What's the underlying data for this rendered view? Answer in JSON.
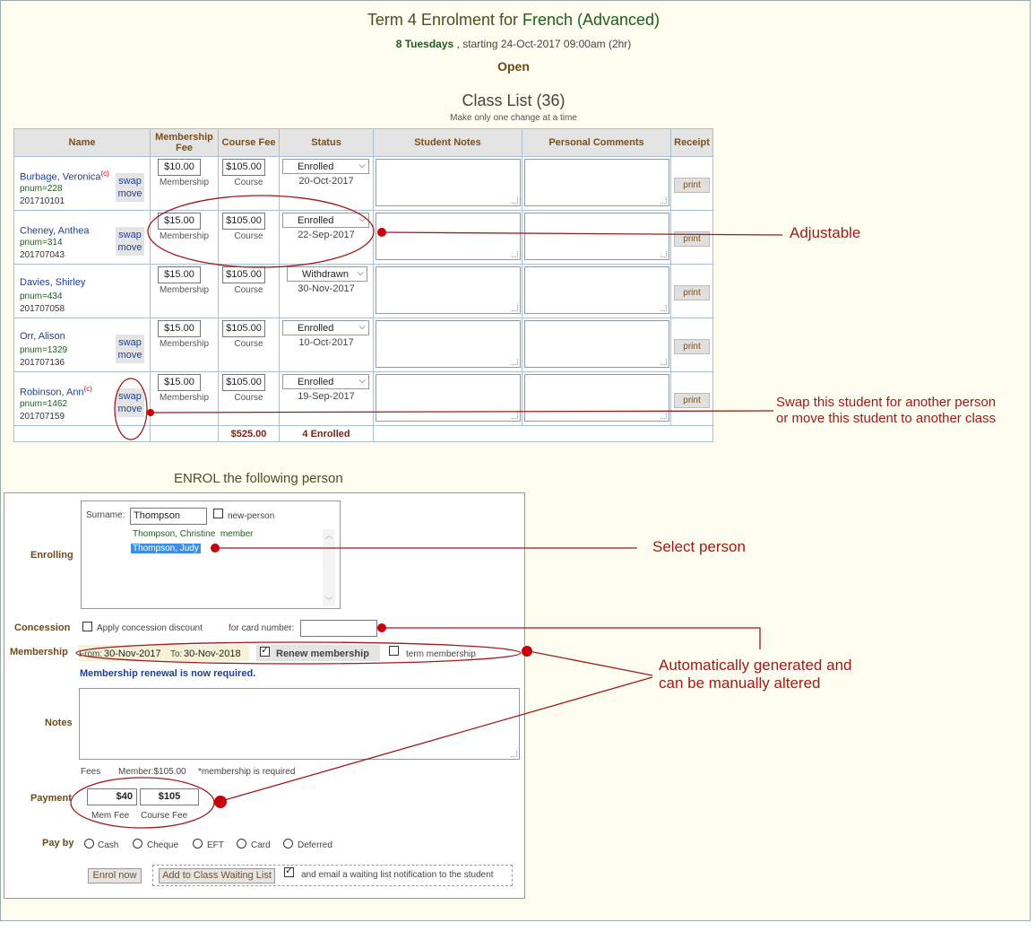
{
  "header": {
    "title_prefix": "Term 4 Enrolment for ",
    "course": "French (Advanced)",
    "sessions": "8 Tuesdays",
    "schedule": ", starting 24-Oct-2017 09:00am (2hr)",
    "status": "Open"
  },
  "class_list": {
    "title": "Class List (36)",
    "note": "Make only one change at a time",
    "columns": [
      "Name",
      "Membership Fee",
      "Course Fee",
      "Status",
      "Student Notes",
      "Personal Comments",
      "Receipt"
    ],
    "rows": [
      {
        "name": "Burbage, Veronica",
        "flag": "(c)",
        "pnum": "pnum=228",
        "mid": "201710101",
        "swap": "swap",
        "move": "move",
        "mem_fee": "$10.00",
        "mem_label": "Membership",
        "course_fee": "$105.00",
        "course_label": "Course",
        "status": "Enrolled",
        "date": "20-Oct-2017",
        "receipt": "print"
      },
      {
        "name": "Cheney, Anthea",
        "flag": "",
        "pnum": "pnum=314",
        "mid": "201707043",
        "swap": "swap",
        "move": "move",
        "mem_fee": "$15.00",
        "mem_label": "Membership",
        "course_fee": "$105.00",
        "course_label": "Course",
        "status": "Enrolled",
        "date": "22-Sep-2017",
        "receipt": "print"
      },
      {
        "name": "Davies, Shirley",
        "flag": "",
        "pnum": "pnum=434",
        "mid": "201707058",
        "swap": "",
        "move": "",
        "mem_fee": "$15.00",
        "mem_label": "Membership",
        "course_fee": "$105.00",
        "course_label": "Course",
        "status": "Withdrawn",
        "date": "30-Nov-2017",
        "receipt": "print"
      },
      {
        "name": "Orr, Alison",
        "flag": "",
        "pnum": "pnum=1329",
        "mid": "201707136",
        "swap": "swap",
        "move": "move",
        "mem_fee": "$15.00",
        "mem_label": "Membership",
        "course_fee": "$105.00",
        "course_label": "Course",
        "status": "Enrolled",
        "date": "10-Oct-2017",
        "receipt": "print"
      },
      {
        "name": "Robinson, Ann",
        "flag": "(c)",
        "pnum": "pnum=1462",
        "mid": "201707159",
        "swap": "swap",
        "move": "move",
        "mem_fee": "$15.00",
        "mem_label": "Membership",
        "course_fee": "$105.00",
        "course_label": "Course",
        "status": "Enrolled",
        "date": "19-Sep-2017",
        "receipt": "print"
      }
    ],
    "total_fee": "$525.00",
    "total_enrolled": "4 Enrolled"
  },
  "enrol": {
    "title": "ENROL the following person",
    "enrolling_label": "Enrolling",
    "surname_label": "Surname:",
    "surname_value": "Thompson",
    "new_person_label": "new-person",
    "results": [
      {
        "text": "Thompson, Christine  member"
      },
      {
        "text": "Thompson, Judy"
      }
    ],
    "concession_label": "Concession",
    "concession_text": "Apply concession discount",
    "card_label": "for card number:",
    "membership_label": "Membership",
    "from_label": "From:",
    "from_date": "30-Nov-2017",
    "to_label": "To:",
    "to_date": "30-Nov-2018",
    "renew_label": "Renew membership",
    "term_label": "term membership",
    "renewal_msg": "Membership renewal is now required.",
    "notes_label": "Notes",
    "fees_label": "Fees",
    "fees_member": "Member:$105.00",
    "fees_note": "*membership is required",
    "payment_label": "Payment",
    "mem_fee": "$40",
    "course_fee": "$105",
    "mem_fee_label": "Mem Fee",
    "course_fee_label": "Course Fee",
    "payby_label": "Pay by",
    "pay_options": [
      "Cash",
      "Cheque",
      "EFT",
      "Card",
      "Deferred"
    ],
    "enrol_button": "Enrol now",
    "waitlist_button": "Add to Class Waiting List",
    "waitlist_email": "and email a waiting list notification to the student"
  },
  "annotations": {
    "adjustable": "Adjustable",
    "swap_line1": "Swap this student for another person",
    "swap_line2": "or move this student to another class",
    "select_person": "Select person",
    "auto_line1": "Automatically generated and",
    "auto_line2": "can be manually altered"
  },
  "colors": {
    "annotation": "#a01a1a",
    "header_text": "#7a4f1a",
    "page_bg": "#fdfdf0"
  }
}
